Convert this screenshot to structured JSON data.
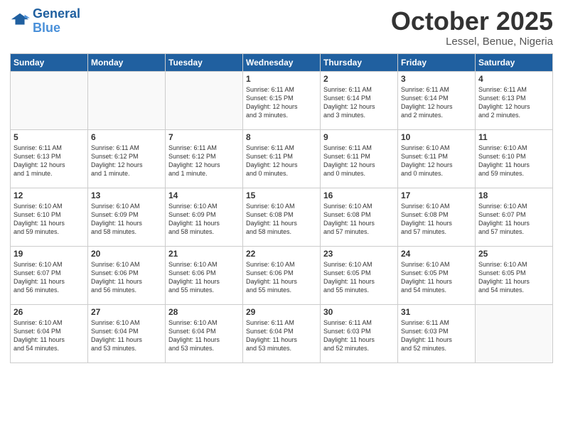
{
  "header": {
    "logo_line1": "General",
    "logo_line2": "Blue",
    "month": "October 2025",
    "location": "Lessel, Benue, Nigeria"
  },
  "days_of_week": [
    "Sunday",
    "Monday",
    "Tuesday",
    "Wednesday",
    "Thursday",
    "Friday",
    "Saturday"
  ],
  "weeks": [
    [
      {
        "day": "",
        "info": ""
      },
      {
        "day": "",
        "info": ""
      },
      {
        "day": "",
        "info": ""
      },
      {
        "day": "1",
        "info": "Sunrise: 6:11 AM\nSunset: 6:15 PM\nDaylight: 12 hours\nand 3 minutes."
      },
      {
        "day": "2",
        "info": "Sunrise: 6:11 AM\nSunset: 6:14 PM\nDaylight: 12 hours\nand 3 minutes."
      },
      {
        "day": "3",
        "info": "Sunrise: 6:11 AM\nSunset: 6:14 PM\nDaylight: 12 hours\nand 2 minutes."
      },
      {
        "day": "4",
        "info": "Sunrise: 6:11 AM\nSunset: 6:13 PM\nDaylight: 12 hours\nand 2 minutes."
      }
    ],
    [
      {
        "day": "5",
        "info": "Sunrise: 6:11 AM\nSunset: 6:13 PM\nDaylight: 12 hours\nand 1 minute."
      },
      {
        "day": "6",
        "info": "Sunrise: 6:11 AM\nSunset: 6:12 PM\nDaylight: 12 hours\nand 1 minute."
      },
      {
        "day": "7",
        "info": "Sunrise: 6:11 AM\nSunset: 6:12 PM\nDaylight: 12 hours\nand 1 minute."
      },
      {
        "day": "8",
        "info": "Sunrise: 6:11 AM\nSunset: 6:11 PM\nDaylight: 12 hours\nand 0 minutes."
      },
      {
        "day": "9",
        "info": "Sunrise: 6:11 AM\nSunset: 6:11 PM\nDaylight: 12 hours\nand 0 minutes."
      },
      {
        "day": "10",
        "info": "Sunrise: 6:10 AM\nSunset: 6:11 PM\nDaylight: 12 hours\nand 0 minutes."
      },
      {
        "day": "11",
        "info": "Sunrise: 6:10 AM\nSunset: 6:10 PM\nDaylight: 11 hours\nand 59 minutes."
      }
    ],
    [
      {
        "day": "12",
        "info": "Sunrise: 6:10 AM\nSunset: 6:10 PM\nDaylight: 11 hours\nand 59 minutes."
      },
      {
        "day": "13",
        "info": "Sunrise: 6:10 AM\nSunset: 6:09 PM\nDaylight: 11 hours\nand 58 minutes."
      },
      {
        "day": "14",
        "info": "Sunrise: 6:10 AM\nSunset: 6:09 PM\nDaylight: 11 hours\nand 58 minutes."
      },
      {
        "day": "15",
        "info": "Sunrise: 6:10 AM\nSunset: 6:08 PM\nDaylight: 11 hours\nand 58 minutes."
      },
      {
        "day": "16",
        "info": "Sunrise: 6:10 AM\nSunset: 6:08 PM\nDaylight: 11 hours\nand 57 minutes."
      },
      {
        "day": "17",
        "info": "Sunrise: 6:10 AM\nSunset: 6:08 PM\nDaylight: 11 hours\nand 57 minutes."
      },
      {
        "day": "18",
        "info": "Sunrise: 6:10 AM\nSunset: 6:07 PM\nDaylight: 11 hours\nand 57 minutes."
      }
    ],
    [
      {
        "day": "19",
        "info": "Sunrise: 6:10 AM\nSunset: 6:07 PM\nDaylight: 11 hours\nand 56 minutes."
      },
      {
        "day": "20",
        "info": "Sunrise: 6:10 AM\nSunset: 6:06 PM\nDaylight: 11 hours\nand 56 minutes."
      },
      {
        "day": "21",
        "info": "Sunrise: 6:10 AM\nSunset: 6:06 PM\nDaylight: 11 hours\nand 55 minutes."
      },
      {
        "day": "22",
        "info": "Sunrise: 6:10 AM\nSunset: 6:06 PM\nDaylight: 11 hours\nand 55 minutes."
      },
      {
        "day": "23",
        "info": "Sunrise: 6:10 AM\nSunset: 6:05 PM\nDaylight: 11 hours\nand 55 minutes."
      },
      {
        "day": "24",
        "info": "Sunrise: 6:10 AM\nSunset: 6:05 PM\nDaylight: 11 hours\nand 54 minutes."
      },
      {
        "day": "25",
        "info": "Sunrise: 6:10 AM\nSunset: 6:05 PM\nDaylight: 11 hours\nand 54 minutes."
      }
    ],
    [
      {
        "day": "26",
        "info": "Sunrise: 6:10 AM\nSunset: 6:04 PM\nDaylight: 11 hours\nand 54 minutes."
      },
      {
        "day": "27",
        "info": "Sunrise: 6:10 AM\nSunset: 6:04 PM\nDaylight: 11 hours\nand 53 minutes."
      },
      {
        "day": "28",
        "info": "Sunrise: 6:10 AM\nSunset: 6:04 PM\nDaylight: 11 hours\nand 53 minutes."
      },
      {
        "day": "29",
        "info": "Sunrise: 6:11 AM\nSunset: 6:04 PM\nDaylight: 11 hours\nand 53 minutes."
      },
      {
        "day": "30",
        "info": "Sunrise: 6:11 AM\nSunset: 6:03 PM\nDaylight: 11 hours\nand 52 minutes."
      },
      {
        "day": "31",
        "info": "Sunrise: 6:11 AM\nSunset: 6:03 PM\nDaylight: 11 hours\nand 52 minutes."
      },
      {
        "day": "",
        "info": ""
      }
    ]
  ]
}
